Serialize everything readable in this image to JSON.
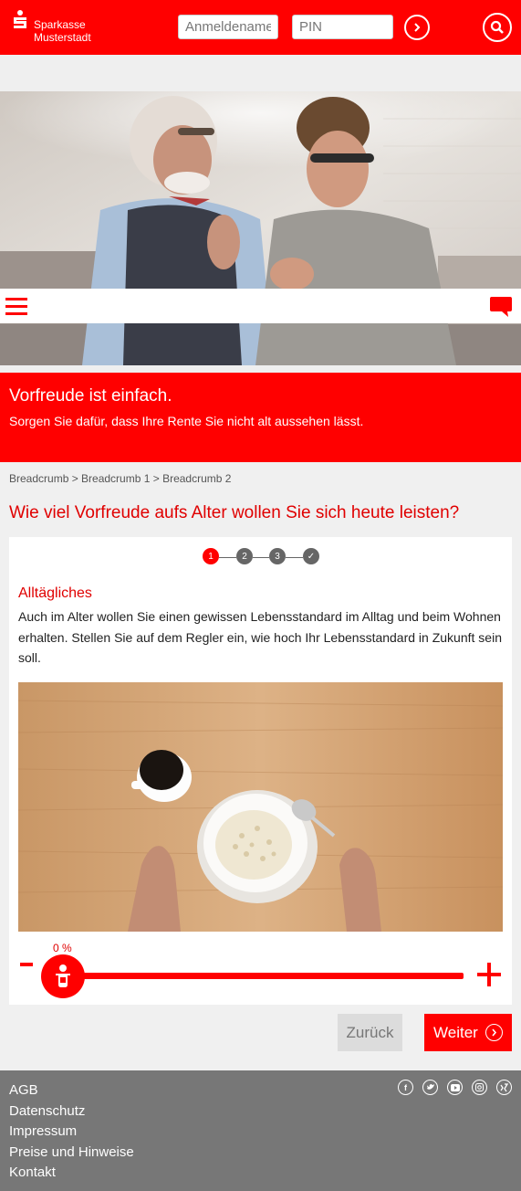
{
  "header": {
    "brand_line1": "Sparkasse",
    "brand_line2": "Musterstadt",
    "username_placeholder": "Anmeldename",
    "pin_placeholder": "PIN"
  },
  "promo": {
    "title": "Vorfreude ist einfach.",
    "subtitle": "Sorgen Sie dafür, dass Ihre Rente Sie nicht alt aussehen lässt."
  },
  "breadcrumb": "Breadcrumb > Breadcrumb 1 > Breadcrumb 2",
  "page_title": "Wie viel Vorfreude aufs Alter wollen Sie sich heute leisten?",
  "stepper": {
    "steps": [
      "1",
      "2",
      "3",
      "✓"
    ],
    "current": 1
  },
  "section": {
    "title": "Alltägliches",
    "text": "Auch im Alter wollen Sie einen gewissen Lebensstandard im Alltag und beim Wohnen erhalten. Stellen Sie auf dem Regler ein, wie hoch Ihr Lebensstandard in Zukunft sein soll."
  },
  "slider": {
    "value_label": "0 %",
    "value": 0,
    "minus_label": "-",
    "plus_label": "+"
  },
  "buttons": {
    "back": "Zurück",
    "next": "Weiter"
  },
  "footer": {
    "links": [
      "AGB",
      "Datenschutz",
      "Impressum",
      "Preise und Hinweise",
      "Kontakt"
    ],
    "social_icons": [
      "facebook-icon",
      "twitter-icon",
      "youtube-icon",
      "instagram-icon",
      "xing-icon"
    ]
  },
  "colors": {
    "brand_red": "#ff0000",
    "footer_gray": "#777777",
    "step_inactive": "#666666"
  }
}
